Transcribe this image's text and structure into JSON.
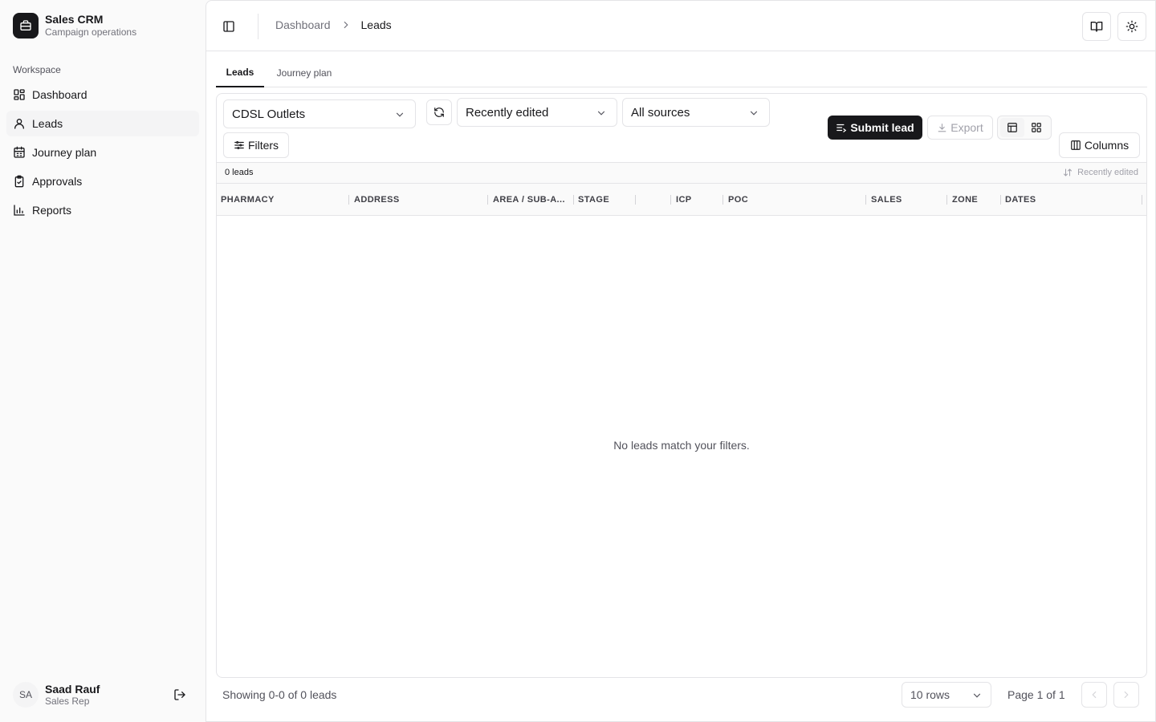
{
  "app": {
    "title": "Sales CRM",
    "subtitle": "Campaign operations"
  },
  "sidebar": {
    "section_label": "Workspace",
    "items": [
      {
        "label": "Dashboard",
        "icon": "dashboard-icon"
      },
      {
        "label": "Leads",
        "icon": "users-icon",
        "active": true
      },
      {
        "label": "Journey plan",
        "icon": "calendar-icon"
      },
      {
        "label": "Approvals",
        "icon": "clipboard-check-icon"
      },
      {
        "label": "Reports",
        "icon": "bar-chart-icon"
      }
    ]
  },
  "user": {
    "initials": "SA",
    "name": "Saad Rauf",
    "role": "Sales Rep"
  },
  "breadcrumb": {
    "parent": "Dashboard",
    "current": "Leads"
  },
  "tabs": [
    {
      "label": "Leads",
      "active": true
    },
    {
      "label": "Journey plan"
    }
  ],
  "toolbar": {
    "outlet_select": "CDSL Outlets",
    "sort_select": "Recently edited",
    "source_select": "All sources",
    "filters_label": "Filters",
    "submit_label": "Submit lead",
    "export_label": "Export",
    "columns_label": "Columns"
  },
  "table": {
    "count_label": "0 leads",
    "sort_indicator": "Recently edited",
    "columns": [
      "PHARMACY",
      "ADDRESS",
      "AREA / SUB-A...",
      "STAGE",
      "ICP",
      "POC",
      "SALES",
      "ZONE",
      "DATES"
    ],
    "empty_message": "No leads match your filters."
  },
  "footer": {
    "showing": "Showing 0-0 of 0 leads",
    "rows_select": "10 rows",
    "page_label": "Page 1 of 1"
  },
  "colors": {
    "primary": "#18181b",
    "border": "#e4e4e7",
    "muted": "#71717a",
    "background": "#fafafa"
  }
}
